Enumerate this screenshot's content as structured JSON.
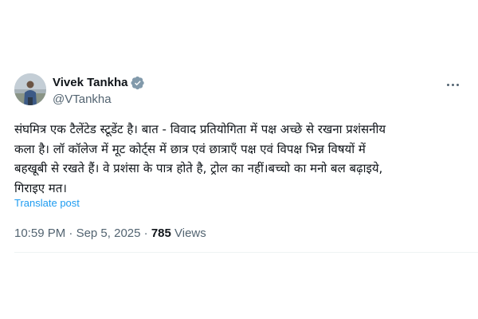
{
  "author": {
    "display_name": "Vivek Tankha",
    "handle": "@VTankha",
    "verified_badge_color": "#829aab"
  },
  "tweet": {
    "text": "संघमित्र एक टैलेंटेड स्टूडेंट है। बात - विवाद प्रतियोगिता में पक्ष अच्छे से रखना प्रशंसनीय\nकला है। लॉ कॉलेज में मूट कोर्ट्स में छात्र एवं छात्राएँ पक्ष एवं विपक्ष भिन्न विषयों में\nबहखूबी से रखते हैं। वे प्रशंसा के पात्र होते है, ट्रोल का नहीं।बच्चो का मनो बल बढ़ाइये,\nगिराइए मत।",
    "translate_label": "Translate post"
  },
  "meta": {
    "time": "10:59 PM",
    "separator_1": " · ",
    "date": "Sep 5, 2025",
    "separator_2": " · ",
    "views_count": "785",
    "views_label": " Views"
  },
  "icons": {
    "more": "more-horizontal-icon",
    "verified": "verified-badge-icon"
  },
  "colors": {
    "link": "#1d9bf0",
    "secondary_text": "#536471",
    "primary_text": "#0f1419"
  }
}
